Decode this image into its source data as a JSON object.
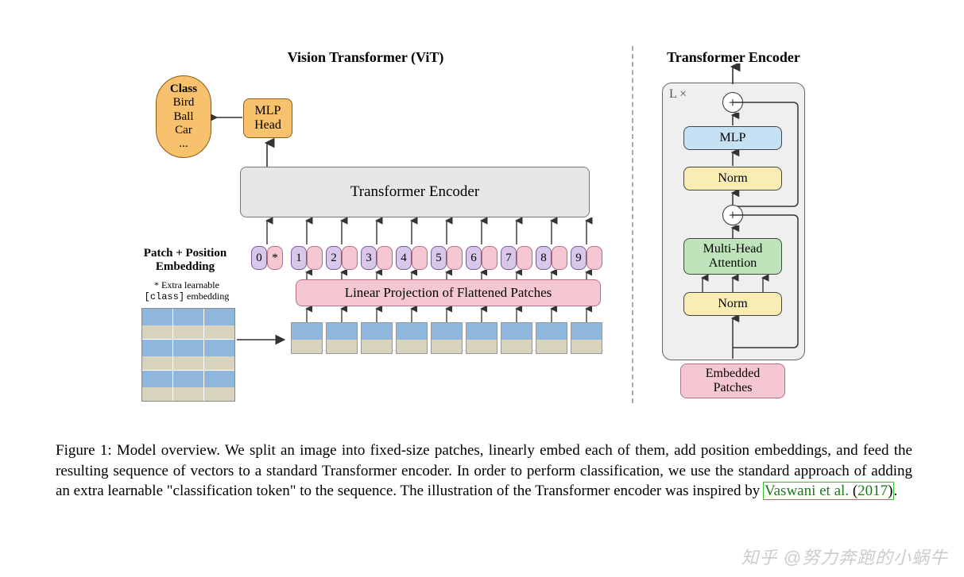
{
  "left_section_title": "Vision Transformer (ViT)",
  "right_section_title": "Transformer Encoder",
  "class_box": {
    "header": "Class",
    "items": [
      "Bird",
      "Ball",
      "Car",
      "..."
    ]
  },
  "mlp_head": {
    "l1": "MLP",
    "l2": "Head"
  },
  "encoder_label": "Transformer Encoder",
  "linear_projection_label": "Linear Projection of Flattened Patches",
  "pe_label": {
    "l1": "Patch + Position",
    "l2": "Embedding"
  },
  "pe_note": {
    "l1": "* Extra learnable",
    "l2": "[class]",
    "l3": " embedding"
  },
  "tokens": [
    "0",
    "*",
    "1",
    "2",
    "3",
    "4",
    "5",
    "6",
    "7",
    "8",
    "9"
  ],
  "encoder_panel": {
    "repeat_prefix": "L ×",
    "plus": "+",
    "mlp": "MLP",
    "norm": "Norm",
    "attn_l1": "Multi-Head",
    "attn_l2": "Attention",
    "embedded_l1": "Embedded",
    "embedded_l2": "Patches"
  },
  "caption_prefix": "Figure 1: Model overview.  We split an image into fixed-size patches, linearly embed each of them, add position embeddings, and feed the resulting sequence of vectors to a standard Transformer encoder.  In order to perform classification, we use the standard approach of adding an extra learnable \"classification token\" to the sequence.  The illustration of the Transformer encoder was inspired by ",
  "citation_author": "Vaswani et al.",
  "citation_year": "2017",
  "watermark": "知乎  @努力奔跑的小蜗牛"
}
